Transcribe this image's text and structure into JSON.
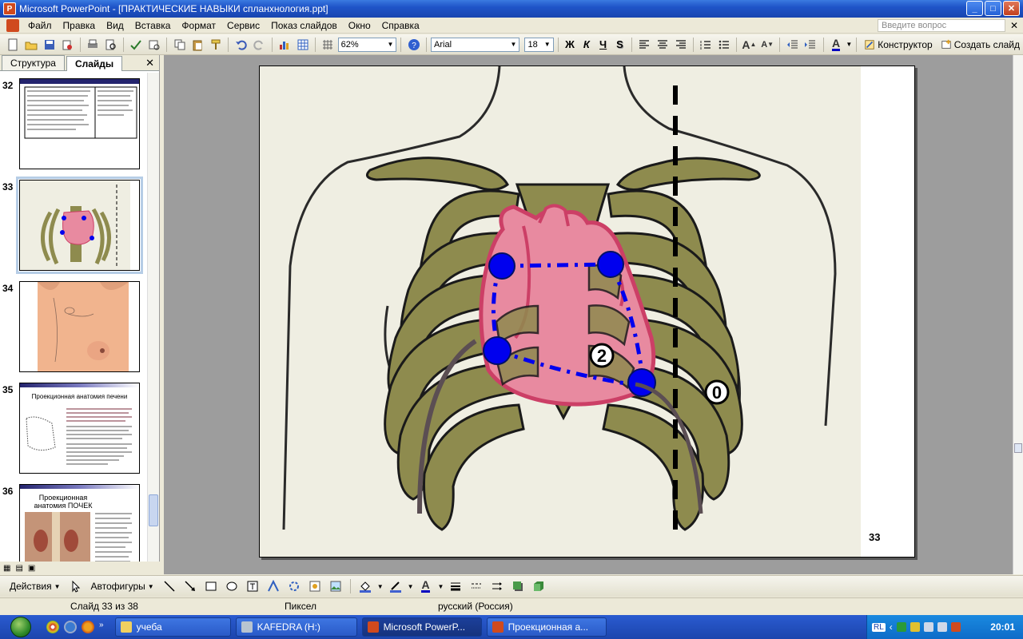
{
  "window": {
    "app_icon": "powerpoint-icon",
    "title": "Microsoft PowerPoint - [ПРАКТИЧЕСКИЕ НАВЫКИ спланхнология.ppt]",
    "minimize": "_",
    "maximize": "□",
    "close": "✕"
  },
  "menu": {
    "items": [
      "Файл",
      "Правка",
      "Вид",
      "Вставка",
      "Формат",
      "Сервис",
      "Показ слайдов",
      "Окно",
      "Справка"
    ],
    "help_placeholder": "Введите вопрос",
    "doc_close": "✕"
  },
  "toolbar": {
    "zoom": "62%",
    "font": "Arial",
    "font_size": "18",
    "bold": "Ж",
    "italic": "К",
    "underline": "Ч",
    "shadow": "S",
    "designer": "Конструктор",
    "new_slide": "Создать слайд"
  },
  "left_pane": {
    "tab_outline": "Структура",
    "tab_slides": "Слайды",
    "close": "✕",
    "thumbnails": [
      {
        "number": "32"
      },
      {
        "number": "33",
        "selected": true
      },
      {
        "number": "34"
      },
      {
        "number": "35",
        "title": "Проекционная анатомия печени"
      },
      {
        "number": "36",
        "title": "Проекционная анатомия ПОЧЕК"
      }
    ]
  },
  "slide": {
    "label_2": "2",
    "label_0": "0",
    "slide_number": "33",
    "colors": {
      "background": "#efeee2",
      "bone": "#8e8b4e",
      "heart": "#e88aa0",
      "heart_outline": "#cc3f66",
      "markers": "#0000ee",
      "dashed_line": "#000000",
      "curve": "#5b4e53"
    }
  },
  "drawing_toolbar": {
    "actions": "Действия",
    "autoshapes": "Автофигуры"
  },
  "status": {
    "slide": "Слайд 33 из 38",
    "design": "Пиксел",
    "language": "русский (Россия)"
  },
  "taskbar": {
    "tasks": [
      {
        "label": "учеба"
      },
      {
        "label": "KAFEDRA (H:)"
      },
      {
        "label": "Microsoft PowerP..."
      },
      {
        "label": "Проекционная а..."
      }
    ],
    "lang": "RL",
    "time": "20:01"
  }
}
